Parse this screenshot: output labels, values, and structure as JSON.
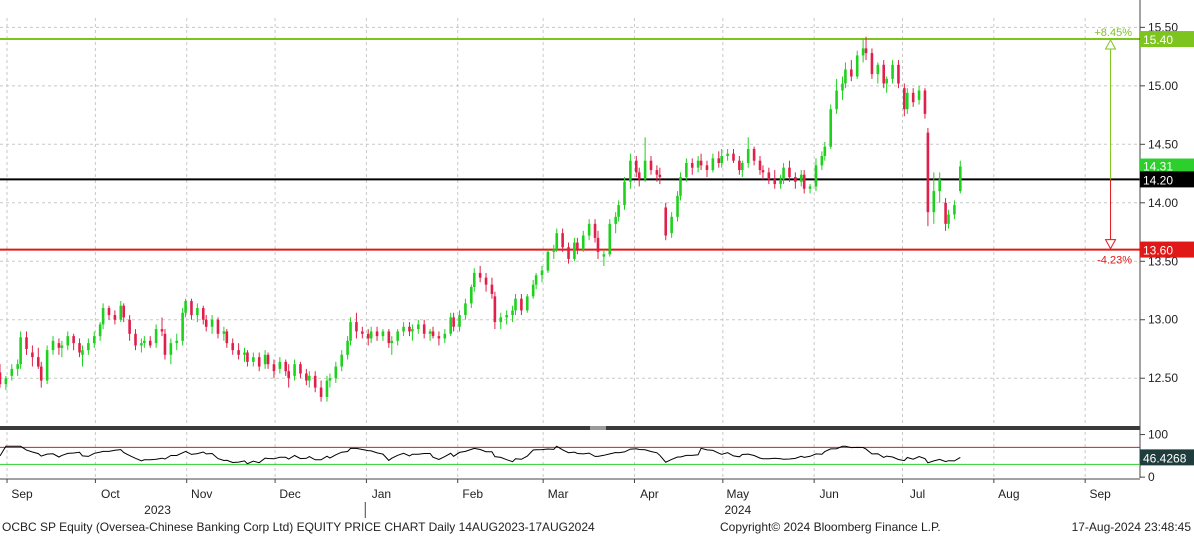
{
  "chart_data": {
    "type": "candlestick",
    "security": "OCBC SP Equity",
    "footer_left": "OCBC SP Equity (Oversea-Chinese Banking Corp Ltd) EQUITY PRICE CHART  Daily 14AUG2023-17AUG2024",
    "footer_center": "Copyright© 2024 Bloomberg Finance L.P.",
    "footer_right": "17-Aug-2024 23:48:45",
    "ylim": [
      12.1,
      15.58
    ],
    "yticks": [
      {
        "value": 12.5,
        "label": "12.50"
      },
      {
        "value": 13.0,
        "label": "13.00"
      },
      {
        "value": 13.5,
        "label": "13.50"
      },
      {
        "value": 14.0,
        "label": "14.00"
      },
      {
        "value": 14.5,
        "label": "14.50"
      },
      {
        "value": 15.0,
        "label": "15.00"
      },
      {
        "value": 15.5,
        "label": "15.50"
      }
    ],
    "months": [
      {
        "label": "Sep",
        "day": 18
      },
      {
        "label": "Oct",
        "day": 48
      },
      {
        "label": "Nov",
        "day": 79
      },
      {
        "label": "Dec",
        "day": 109
      },
      {
        "label": "Jan",
        "day": 140
      },
      {
        "label": "Feb",
        "day": 171
      },
      {
        "label": "Mar",
        "day": 200
      },
      {
        "label": "Apr",
        "day": 231
      },
      {
        "label": "May",
        "day": 261
      },
      {
        "label": "Jun",
        "day": 292
      },
      {
        "label": "Jul",
        "day": 322
      },
      {
        "label": "Aug",
        "day": 353
      },
      {
        "label": "Sep",
        "day": 384
      }
    ],
    "years": [
      {
        "label": "2023",
        "day": 64
      },
      {
        "label": "2024",
        "day": 261
      }
    ],
    "year_divider_day": 124,
    "levels": [
      {
        "name": "resistance",
        "value": 15.4,
        "label": "15.40",
        "color": "#7dc41f"
      },
      {
        "name": "pivot",
        "value": 14.2,
        "label": "14.20",
        "color": "#000000"
      },
      {
        "name": "support",
        "value": 13.6,
        "label": "13.60",
        "color": "#e01818"
      }
    ],
    "last_price": {
      "value": 14.31,
      "label": "14.31",
      "color": "#2ccf2c"
    },
    "range_annotation": {
      "day": 377,
      "up_label": "+8.45%",
      "down_label": "-4.23%",
      "up_color": "#7dc41f",
      "down_color": "#e01818"
    },
    "candle_colors": {
      "up": "#1fd11f",
      "down": "#e0204a"
    },
    "candles": [
      [
        0,
        12.55,
        12.62,
        12.42,
        12.45
      ],
      [
        2,
        12.45,
        12.52,
        12.4,
        12.5
      ],
      [
        4,
        12.52,
        12.62,
        12.48,
        12.58
      ],
      [
        6,
        12.58,
        12.66,
        12.52,
        12.62
      ],
      [
        7,
        12.62,
        12.9,
        12.58,
        12.85
      ],
      [
        9,
        12.85,
        12.9,
        12.7,
        12.75
      ],
      [
        11,
        12.72,
        12.78,
        12.6,
        12.68
      ],
      [
        13,
        12.68,
        12.76,
        12.58,
        12.6
      ],
      [
        14,
        12.6,
        12.64,
        12.42,
        12.48
      ],
      [
        16,
        12.48,
        12.78,
        12.45,
        12.74
      ],
      [
        18,
        12.74,
        12.86,
        12.7,
        12.82
      ],
      [
        20,
        12.8,
        12.84,
        12.7,
        12.76
      ],
      [
        21,
        12.76,
        12.82,
        12.68,
        12.78
      ],
      [
        23,
        12.78,
        12.9,
        12.74,
        12.86
      ],
      [
        25,
        12.86,
        12.88,
        12.74,
        12.8
      ],
      [
        27,
        12.8,
        12.84,
        12.68,
        12.72
      ],
      [
        28,
        12.7,
        12.78,
        12.6,
        12.74
      ],
      [
        30,
        12.74,
        12.84,
        12.7,
        12.8
      ],
      [
        32,
        12.8,
        12.9,
        12.76,
        12.86
      ],
      [
        34,
        12.86,
        12.98,
        12.82,
        12.96
      ],
      [
        35,
        12.96,
        13.14,
        12.92,
        13.1
      ],
      [
        37,
        13.1,
        13.12,
        13.0,
        13.04
      ],
      [
        39,
        13.04,
        13.08,
        12.96,
        13.0
      ],
      [
        41,
        13.0,
        13.16,
        12.98,
        13.12
      ],
      [
        42,
        13.12,
        13.14,
        12.98,
        13.02
      ],
      [
        44,
        13.0,
        13.04,
        12.82,
        12.88
      ],
      [
        46,
        12.88,
        12.92,
        12.74,
        12.78
      ],
      [
        48,
        12.78,
        12.84,
        12.72,
        12.8
      ],
      [
        49,
        12.8,
        12.86,
        12.76,
        12.82
      ],
      [
        51,
        12.82,
        12.86,
        12.76,
        12.78
      ],
      [
        53,
        12.8,
        12.96,
        12.76,
        12.92
      ],
      [
        55,
        12.92,
        13.02,
        12.86,
        12.9
      ],
      [
        56,
        12.88,
        12.92,
        12.66,
        12.7
      ],
      [
        58,
        12.7,
        12.84,
        12.62,
        12.8
      ],
      [
        60,
        12.8,
        12.88,
        12.74,
        12.82
      ],
      [
        62,
        12.82,
        13.1,
        12.78,
        13.06
      ],
      [
        63,
        13.06,
        13.18,
        13.02,
        13.16
      ],
      [
        65,
        13.16,
        13.18,
        13.0,
        13.04
      ],
      [
        67,
        13.04,
        13.14,
        12.98,
        13.1
      ],
      [
        69,
        13.1,
        13.12,
        12.96,
        13.0
      ],
      [
        70,
        13.0,
        13.04,
        12.9,
        12.94
      ],
      [
        72,
        12.94,
        13.04,
        12.88,
        13.0
      ],
      [
        74,
        13.0,
        13.02,
        12.84,
        12.88
      ],
      [
        76,
        12.88,
        12.94,
        12.82,
        12.9
      ],
      [
        77,
        12.9,
        12.92,
        12.76,
        12.8
      ],
      [
        79,
        12.8,
        12.84,
        12.7,
        12.74
      ],
      [
        81,
        12.74,
        12.8,
        12.66,
        12.7
      ],
      [
        83,
        12.7,
        12.76,
        12.64,
        12.72
      ],
      [
        84,
        12.72,
        12.74,
        12.6,
        12.64
      ],
      [
        86,
        12.64,
        12.72,
        12.6,
        12.68
      ],
      [
        88,
        12.68,
        12.72,
        12.56,
        12.6
      ],
      [
        90,
        12.62,
        12.74,
        12.58,
        12.7
      ],
      [
        91,
        12.7,
        12.72,
        12.58,
        12.62
      ],
      [
        93,
        12.62,
        12.66,
        12.5,
        12.56
      ],
      [
        95,
        12.58,
        12.68,
        12.54,
        12.64
      ],
      [
        97,
        12.64,
        12.66,
        12.52,
        12.56
      ],
      [
        98,
        12.56,
        12.62,
        12.42,
        12.5
      ],
      [
        100,
        12.52,
        12.66,
        12.48,
        12.62
      ],
      [
        102,
        12.62,
        12.64,
        12.5,
        12.54
      ],
      [
        104,
        12.54,
        12.58,
        12.44,
        12.48
      ],
      [
        105,
        12.48,
        12.56,
        12.42,
        12.52
      ],
      [
        107,
        12.52,
        12.56,
        12.38,
        12.42
      ],
      [
        109,
        12.42,
        12.48,
        12.3,
        12.34
      ],
      [
        111,
        12.34,
        12.52,
        12.3,
        12.48
      ],
      [
        112,
        12.48,
        12.54,
        12.42,
        12.5
      ],
      [
        114,
        12.5,
        12.64,
        12.46,
        12.6
      ],
      [
        116,
        12.6,
        12.74,
        12.56,
        12.7
      ],
      [
        118,
        12.7,
        12.86,
        12.66,
        12.82
      ],
      [
        119,
        12.82,
        13.02,
        12.78,
        12.98
      ],
      [
        121,
        12.98,
        13.06,
        12.84,
        12.9
      ],
      [
        123,
        12.9,
        12.94,
        12.84,
        12.88
      ],
      [
        125,
        12.88,
        12.92,
        12.78,
        12.84
      ],
      [
        126,
        12.84,
        12.94,
        12.8,
        12.9
      ],
      [
        128,
        12.9,
        12.94,
        12.82,
        12.86
      ],
      [
        130,
        12.86,
        12.92,
        12.82,
        12.9
      ],
      [
        132,
        12.9,
        12.92,
        12.76,
        12.8
      ],
      [
        133,
        12.8,
        12.86,
        12.7,
        12.82
      ],
      [
        135,
        12.82,
        12.92,
        12.78,
        12.9
      ],
      [
        137,
        12.9,
        12.98,
        12.86,
        12.94
      ],
      [
        139,
        12.94,
        12.98,
        12.86,
        12.9
      ],
      [
        140,
        12.9,
        12.96,
        12.82,
        12.92
      ],
      [
        142,
        12.92,
        13.0,
        12.88,
        12.96
      ],
      [
        144,
        12.96,
        13.0,
        12.84,
        12.88
      ],
      [
        146,
        12.88,
        12.92,
        12.82,
        12.9
      ],
      [
        147,
        12.9,
        12.94,
        12.84,
        12.86
      ],
      [
        149,
        12.86,
        12.9,
        12.78,
        12.84
      ],
      [
        151,
        12.84,
        12.92,
        12.8,
        12.88
      ],
      [
        153,
        12.88,
        13.06,
        12.86,
        13.02
      ],
      [
        154,
        13.02,
        13.06,
        12.9,
        12.94
      ],
      [
        156,
        12.94,
        13.08,
        12.9,
        13.04
      ],
      [
        158,
        13.04,
        13.18,
        13.0,
        13.14
      ],
      [
        160,
        13.14,
        13.3,
        13.1,
        13.28
      ],
      [
        161,
        13.28,
        13.44,
        13.24,
        13.4
      ],
      [
        163,
        13.4,
        13.46,
        13.32,
        13.36
      ],
      [
        165,
        13.36,
        13.4,
        13.24,
        13.3
      ],
      [
        167,
        13.3,
        13.36,
        13.18,
        13.22
      ],
      [
        168,
        13.2,
        13.24,
        12.92,
        12.98
      ],
      [
        170,
        12.98,
        13.06,
        12.92,
        13.02
      ],
      [
        172,
        13.02,
        13.08,
        12.96,
        13.04
      ],
      [
        174,
        13.04,
        13.12,
        12.98,
        13.08
      ],
      [
        175,
        13.08,
        13.22,
        13.04,
        13.18
      ],
      [
        177,
        13.18,
        13.22,
        13.04,
        13.08
      ],
      [
        179,
        13.08,
        13.22,
        13.06,
        13.2
      ],
      [
        181,
        13.2,
        13.34,
        13.18,
        13.3
      ],
      [
        182,
        13.3,
        13.4,
        13.26,
        13.38
      ],
      [
        184,
        13.38,
        13.46,
        13.32,
        13.42
      ],
      [
        186,
        13.42,
        13.6,
        13.4,
        13.58
      ],
      [
        188,
        13.58,
        13.64,
        13.52,
        13.6
      ],
      [
        189,
        13.6,
        13.78,
        13.58,
        13.74
      ],
      [
        191,
        13.74,
        13.78,
        13.58,
        13.62
      ],
      [
        193,
        13.62,
        13.66,
        13.48,
        13.52
      ],
      [
        195,
        13.52,
        13.7,
        13.5,
        13.66
      ],
      [
        196,
        13.66,
        13.7,
        13.56,
        13.6
      ],
      [
        198,
        13.6,
        13.76,
        13.58,
        13.72
      ],
      [
        200,
        13.72,
        13.86,
        13.68,
        13.82
      ],
      [
        202,
        13.82,
        13.86,
        13.66,
        13.7
      ],
      [
        203,
        13.7,
        13.76,
        13.52,
        13.58
      ],
      [
        205,
        13.54,
        13.6,
        13.46,
        13.56
      ],
      [
        207,
        13.56,
        13.86,
        13.54,
        13.82
      ],
      [
        209,
        13.82,
        13.92,
        13.74,
        13.88
      ],
      [
        210,
        13.88,
        14.02,
        13.84,
        13.98
      ],
      [
        212,
        13.98,
        14.22,
        13.94,
        14.18
      ],
      [
        214,
        14.18,
        14.42,
        14.12,
        14.36
      ],
      [
        216,
        14.36,
        14.4,
        14.22,
        14.26
      ],
      [
        217,
        14.26,
        14.3,
        14.14,
        14.2
      ],
      [
        219,
        14.2,
        14.56,
        14.18,
        14.36
      ],
      [
        221,
        14.36,
        14.4,
        14.24,
        14.28
      ],
      [
        223,
        14.28,
        14.32,
        14.18,
        14.24
      ],
      [
        224,
        14.24,
        14.3,
        14.16,
        14.22
      ],
      [
        226,
        13.96,
        14.0,
        13.68,
        13.72
      ],
      [
        228,
        13.74,
        13.92,
        13.7,
        13.88
      ],
      [
        230,
        13.88,
        14.1,
        13.84,
        14.06
      ],
      [
        231,
        14.06,
        14.26,
        14.02,
        14.22
      ],
      [
        233,
        14.22,
        14.38,
        14.18,
        14.34
      ],
      [
        235,
        14.34,
        14.38,
        14.24,
        14.3
      ],
      [
        237,
        14.3,
        14.4,
        14.26,
        14.36
      ],
      [
        238,
        14.36,
        14.42,
        14.28,
        14.32
      ],
      [
        240,
        14.32,
        14.36,
        14.22,
        14.28
      ],
      [
        242,
        14.28,
        14.42,
        14.26,
        14.38
      ],
      [
        244,
        14.38,
        14.44,
        14.3,
        14.34
      ],
      [
        245,
        14.34,
        14.46,
        14.3,
        14.4
      ],
      [
        247,
        14.4,
        14.46,
        14.36,
        14.42
      ],
      [
        249,
        14.42,
        14.46,
        14.34,
        14.36
      ],
      [
        251,
        14.36,
        14.4,
        14.24,
        14.28
      ],
      [
        252,
        14.28,
        14.36,
        14.22,
        14.34
      ],
      [
        254,
        14.34,
        14.56,
        14.3,
        14.46
      ],
      [
        256,
        14.46,
        14.48,
        14.32,
        14.36
      ],
      [
        258,
        14.36,
        14.4,
        14.24,
        14.28
      ],
      [
        259,
        14.28,
        14.32,
        14.2,
        14.26
      ],
      [
        261,
        14.26,
        14.3,
        14.16,
        14.2
      ],
      [
        263,
        14.2,
        14.28,
        14.12,
        14.16
      ],
      [
        265,
        14.16,
        14.24,
        14.12,
        14.2
      ],
      [
        266,
        14.2,
        14.34,
        14.16,
        14.3
      ],
      [
        268,
        14.3,
        14.36,
        14.18,
        14.22
      ],
      [
        270,
        14.22,
        14.26,
        14.12,
        14.18
      ],
      [
        272,
        14.18,
        14.28,
        14.14,
        14.24
      ],
      [
        273,
        14.24,
        14.28,
        14.08,
        14.12
      ],
      [
        275,
        14.12,
        14.16,
        14.08,
        14.14
      ],
      [
        277,
        14.14,
        14.38,
        14.1,
        14.32
      ],
      [
        279,
        14.32,
        14.44,
        14.28,
        14.4
      ],
      [
        280,
        14.4,
        14.52,
        14.36,
        14.48
      ],
      [
        282,
        14.48,
        14.84,
        14.46,
        14.8
      ],
      [
        284,
        14.8,
        15.06,
        14.76,
        14.96
      ],
      [
        286,
        14.96,
        15.08,
        14.88,
        15.02
      ],
      [
        287,
        15.02,
        15.2,
        14.98,
        15.14
      ],
      [
        289,
        15.14,
        15.22,
        15.04,
        15.08
      ],
      [
        291,
        15.08,
        15.3,
        15.06,
        15.26
      ],
      [
        293,
        15.26,
        15.4,
        15.2,
        15.32
      ],
      [
        294,
        15.32,
        15.42,
        15.22,
        15.28
      ],
      [
        296,
        15.28,
        15.32,
        15.06,
        15.1
      ],
      [
        298,
        15.1,
        15.2,
        15.02,
        15.18
      ],
      [
        300,
        15.18,
        15.22,
        14.98,
        15.02
      ],
      [
        301,
        15.02,
        15.08,
        14.94,
        15.06
      ],
      [
        303,
        15.06,
        15.22,
        15.02,
        15.18
      ],
      [
        305,
        15.18,
        15.22,
        14.98,
        15.02
      ],
      [
        307,
        14.98,
        15.02,
        14.74,
        14.8
      ],
      [
        308,
        14.8,
        14.98,
        14.76,
        14.94
      ],
      [
        310,
        14.94,
        14.98,
        14.82,
        14.86
      ],
      [
        312,
        14.88,
        15.0,
        14.84,
        14.96
      ],
      [
        314,
        14.96,
        14.98,
        14.72,
        14.76
      ],
      [
        315,
        14.6,
        14.64,
        13.8,
        13.92
      ],
      [
        317,
        13.92,
        14.26,
        13.82,
        14.1
      ],
      [
        319,
        14.1,
        14.26,
        14.0,
        14.2
      ],
      [
        321,
        14.0,
        14.04,
        13.76,
        13.82
      ],
      [
        322,
        13.82,
        13.94,
        13.78,
        13.9
      ],
      [
        324,
        13.9,
        14.02,
        13.86,
        13.98
      ],
      [
        326,
        14.1,
        14.36,
        14.08,
        14.31
      ]
    ],
    "indicator": {
      "ylim": [
        -2,
        106
      ],
      "yticks": [
        {
          "value": 100,
          "label": "100"
        },
        {
          "value": 0,
          "label": "0"
        }
      ],
      "upper_value": 70,
      "lower_value": 30,
      "upper_color": "#e01818",
      "lower_color": "#2ccf2c",
      "last_value": 46.4268,
      "last_label": "46.4268",
      "line_color": "#000000",
      "label_bg": "#1f3d3d"
    }
  }
}
